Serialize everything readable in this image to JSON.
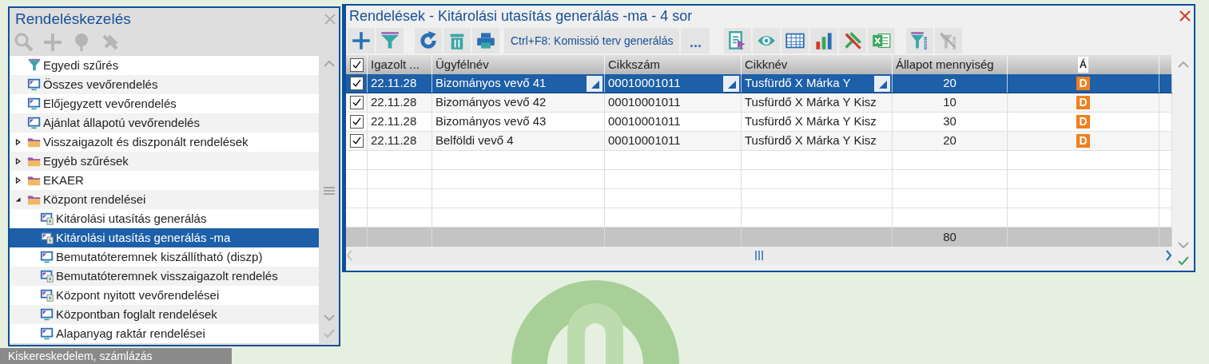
{
  "background_menu": [
    {
      "label": "Kiskereskedelem, számlázás"
    }
  ],
  "nav_panel": {
    "title": "Rendeléskezelés",
    "items": [
      {
        "kind": "filter",
        "label": "Egyedi szűrés",
        "selected": false
      },
      {
        "kind": "view",
        "label": "Összes vevőrendelés",
        "selected": false
      },
      {
        "kind": "view",
        "label": "Előjegyzett vevőrendelés",
        "selected": false
      },
      {
        "kind": "view",
        "label": "Ajánlat állapotú vevőrendelés",
        "selected": false
      },
      {
        "kind": "folder",
        "label": "Visszaigazolt és diszponált rendelések",
        "selected": false,
        "expanded": false
      },
      {
        "kind": "folder",
        "label": "Egyéb szűrések",
        "selected": false,
        "expanded": false
      },
      {
        "kind": "folder",
        "label": "EKAER",
        "selected": false,
        "expanded": false
      },
      {
        "kind": "folder",
        "label": "Központ rendelései",
        "selected": false,
        "expanded": true,
        "children": [
          {
            "kind": "view-run",
            "label": "Kitárolási utasítás generálás",
            "selected": false
          },
          {
            "kind": "view-run",
            "label": "Kitárolási utasítás generálás -ma",
            "selected": true
          },
          {
            "kind": "view",
            "label": "Bemutatóteremnek kiszállítható (diszp)",
            "selected": false
          },
          {
            "kind": "view-run",
            "label": "Bemutatóteremnek visszaigazolt rendelés",
            "selected": false
          },
          {
            "kind": "view-run",
            "label": "Központ nyitott vevőrendelései",
            "selected": false
          },
          {
            "kind": "view",
            "label": "Központban foglalt rendelések",
            "selected": false
          },
          {
            "kind": "view",
            "label": "Alapanyag raktár rendelései",
            "selected": false
          }
        ]
      }
    ]
  },
  "orders_window": {
    "title": "Rendelések - Kitárolási utasítás generálás -ma - 4 sor",
    "command_button": "Ctrl+F8: Komissió terv generálás",
    "more_button": "...",
    "table": {
      "all_checked": true,
      "columns": [
        "Igazolt ...",
        "Ügyfélnév",
        "Cikkszám",
        "Cikknév",
        "Állapot mennyiség",
        "Á"
      ],
      "rows": [
        {
          "checked": true,
          "selected": true,
          "cells": [
            "22.11.28",
            "Bizományos vevő 41",
            "00010001011",
            "Tusfürdő X Márka Y",
            "20"
          ],
          "status": "D"
        },
        {
          "checked": true,
          "selected": false,
          "cells": [
            "22.11.28",
            "Bizományos vevő 42",
            "00010001011",
            "Tusfürdő X Márka Y Kisz",
            "10"
          ],
          "status": "D"
        },
        {
          "checked": true,
          "selected": false,
          "cells": [
            "22.11.28",
            "Bizományos vevő 43",
            "00010001011",
            "Tusfürdő X Márka Y Kisz",
            "30"
          ],
          "status": "D"
        },
        {
          "checked": true,
          "selected": false,
          "cells": [
            "22.11.28",
            "Belföldi vevő 4",
            "00010001011",
            "Tusfürdő X Márka Y Kisz",
            "20"
          ],
          "status": "D"
        }
      ],
      "total": "80"
    }
  }
}
